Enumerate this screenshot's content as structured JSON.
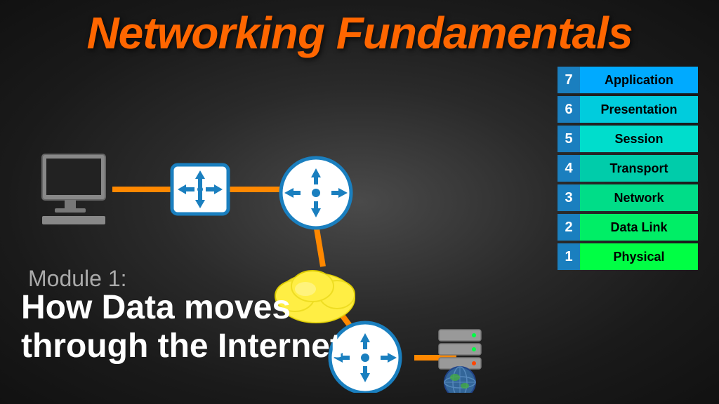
{
  "title": "Networking Fundamentals",
  "module": {
    "label": "Module 1:",
    "subtitle_line1": "How Data moves",
    "subtitle_line2": "through the Internet"
  },
  "osi_layers": [
    {
      "number": "7",
      "label": "Application"
    },
    {
      "number": "6",
      "label": "Presentation"
    },
    {
      "number": "5",
      "label": "Session"
    },
    {
      "number": "4",
      "label": "Transport"
    },
    {
      "number": "3",
      "label": "Network"
    },
    {
      "number": "2",
      "label": "Data Link"
    },
    {
      "number": "1",
      "label": "Physical"
    }
  ],
  "colors": {
    "title": "#ff6600",
    "osi_num_bg": "#1a7fbf",
    "layer7": "#00aaff",
    "layer6": "#00ccdd",
    "layer5": "#00ddcc",
    "layer4": "#00ccaa",
    "layer3": "#00dd88",
    "layer2": "#00ee66",
    "layer1": "#00ff44",
    "cable": "#ff8800",
    "router_border": "#1a7fbf",
    "switch_border": "#1a7fbf"
  }
}
